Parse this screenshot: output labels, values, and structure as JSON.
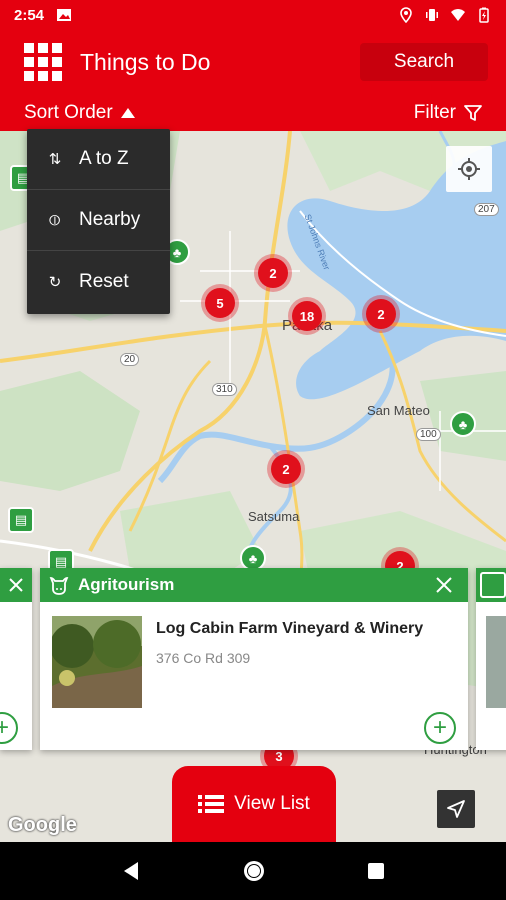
{
  "status_bar": {
    "time": "2:54"
  },
  "header": {
    "title": "Things to Do",
    "search_label": "Search"
  },
  "sort_bar": {
    "sort_label": "Sort Order",
    "filter_label": "Filter"
  },
  "sort_menu": [
    {
      "label": "A to Z",
      "icon": "sort-icon"
    },
    {
      "label": "Nearby",
      "icon": "nearby-icon"
    },
    {
      "label": "Reset",
      "icon": "reset-icon"
    }
  ],
  "map": {
    "labels": [
      "Palatka",
      "San Mateo",
      "Satsuma",
      "Huntington",
      "St Johns River"
    ],
    "road_shields": [
      "207",
      "20",
      "310",
      "100"
    ],
    "clusters": [
      "2",
      "5",
      "18",
      "2",
      "2",
      "2",
      "3"
    ],
    "attribution": "Google"
  },
  "card": {
    "category": "Agritourism",
    "title": "Log Cabin Farm Vineyard & Winery",
    "address": "376 Co Rd 309"
  },
  "view_list_label": "View List",
  "colors": {
    "brand_red": "#e4000f",
    "category_green": "#2f9e41"
  }
}
